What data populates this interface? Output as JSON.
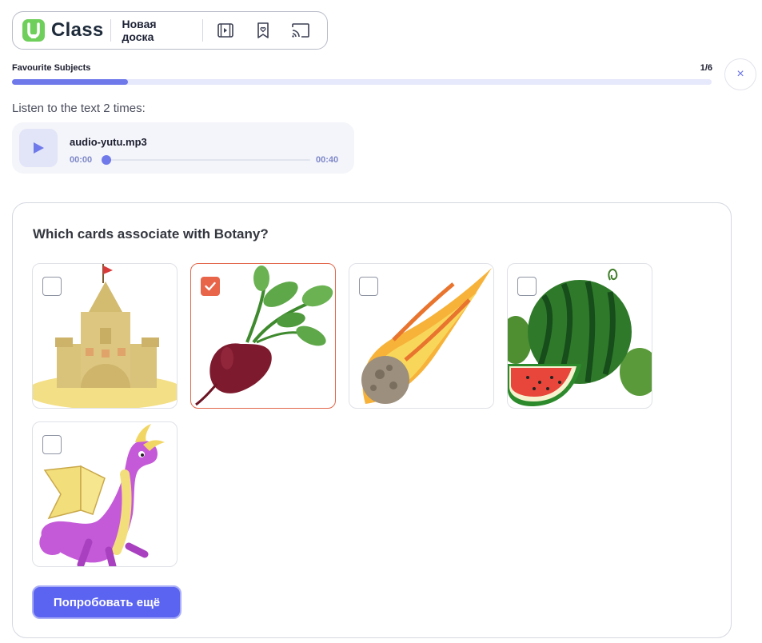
{
  "header": {
    "app_name": "Class",
    "board_label": "Новая доска",
    "icons": [
      "logo-icon",
      "video-icon",
      "bookmark-icon",
      "cast-icon"
    ]
  },
  "progress": {
    "title": "Favourite Subjects",
    "counter": "1/6",
    "fraction": 0.166,
    "close_label": "×"
  },
  "instruction": "Listen to the text 2 times:",
  "audio": {
    "file_name": "audio-yutu.mp3",
    "current_time": "00:00",
    "duration": "00:40",
    "played_fraction": 0
  },
  "task": {
    "question": "Which cards associate with Botany?",
    "cards": [
      {
        "id": "sandcastle",
        "checked": false
      },
      {
        "id": "beetroot",
        "checked": true
      },
      {
        "id": "meteor",
        "checked": false
      },
      {
        "id": "watermelon",
        "checked": false
      },
      {
        "id": "dragon",
        "checked": false
      }
    ],
    "retry_label": "Попробовать ещё"
  },
  "colors": {
    "accent": "#5b63f1",
    "progress": "#6f79ea",
    "selected": "#e8654a",
    "logo": "#6fcf5b"
  }
}
